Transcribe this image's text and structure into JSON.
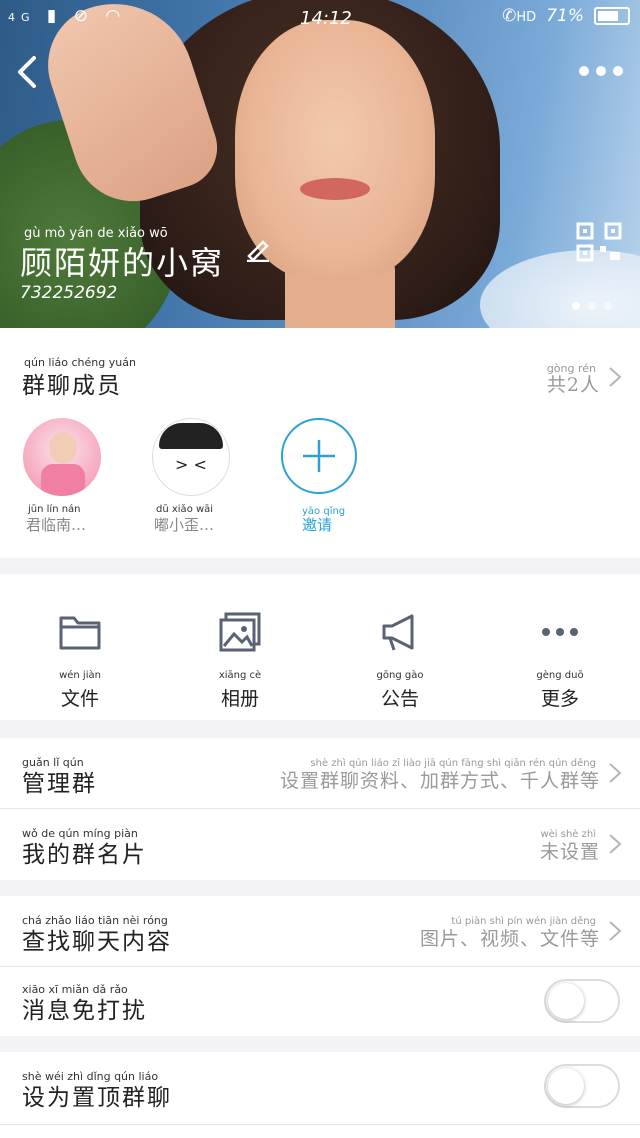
{
  "status_bar": {
    "network": "4G",
    "time": "14:12",
    "hd": "HD",
    "battery": "71%"
  },
  "header": {
    "group_name": "顾陌妍的小窝",
    "group_name_pinyin": "gù mò yán de xiǎo wō",
    "group_id": "732252692"
  },
  "members": {
    "title": "群聊成员",
    "title_pinyin": "qún liáo chéng yuán",
    "count": "共2人",
    "count_pinyin": "gòng rén",
    "list": [
      {
        "name": "君临南…",
        "pinyin": "jūn lín nán"
      },
      {
        "name": "嘟小歪…",
        "pinyin": "dū xiǎo wāi"
      }
    ],
    "invite_label": "邀请",
    "invite_pinyin": "yāo qǐng"
  },
  "tools": [
    {
      "label": "文件",
      "pinyin": "wén jiàn",
      "icon": "folder-icon"
    },
    {
      "label": "相册",
      "pinyin": "xiāng cè",
      "icon": "photo-album-icon"
    },
    {
      "label": "公告",
      "pinyin": "gōng gào",
      "icon": "megaphone-icon"
    },
    {
      "label": "更多",
      "pinyin": "gèng duō",
      "icon": "more-icon"
    }
  ],
  "settings": {
    "manage": {
      "label": "管理群",
      "pinyin": "guǎn lǐ qún",
      "value": "设置群聊资料、加群方式、千人群等",
      "value_pinyin": "shè zhì qún liáo zī liào     jiā qún fāng shì     qiān rén qún děng"
    },
    "my_card": {
      "label": "我的群名片",
      "pinyin": "wǒ de qún míng piàn",
      "value": "未设置",
      "value_pinyin": "wèi shè zhì"
    },
    "search": {
      "label": "查找聊天内容",
      "pinyin": "chá zhǎo liáo tiān nèi róng",
      "value": "图片、视频、文件等",
      "value_pinyin": "tú piàn     shì pín     wén jiàn děng"
    },
    "mute": {
      "label": "消息免打扰",
      "pinyin": "xiāo xī miǎn dǎ rǎo",
      "on": false
    },
    "pin": {
      "label": "设为置顶群聊",
      "pinyin": "shè wéi zhì dǐng qún liáo",
      "on": false
    }
  },
  "colors": {
    "accent": "#2ba3d8",
    "icon_gray": "#5a6274"
  }
}
